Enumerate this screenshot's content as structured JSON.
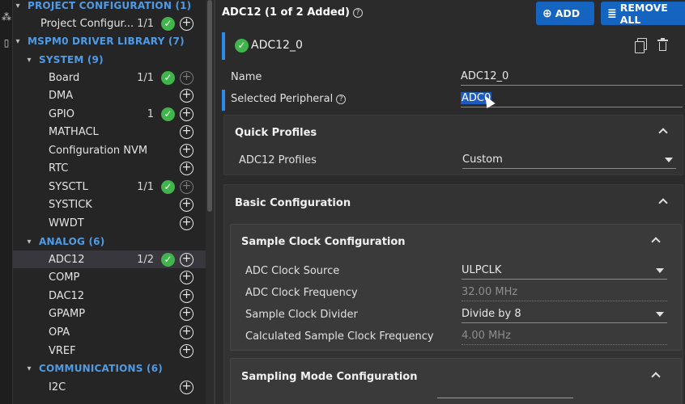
{
  "tree": {
    "project_configuration": "PROJECT CONFIGURATION (1)",
    "project_configuration_item": {
      "label": "Project Configur...",
      "count": "1/1"
    },
    "driver_library": "MSPM0 DRIVER LIBRARY (7)",
    "system_section": "SYSTEM (9)",
    "system_items": [
      {
        "label": "Board",
        "count": "1/1"
      },
      {
        "label": "DMA",
        "count": ""
      },
      {
        "label": "GPIO",
        "count": "1"
      },
      {
        "label": "MATHACL",
        "count": ""
      },
      {
        "label": "Configuration NVM",
        "count": ""
      },
      {
        "label": "RTC",
        "count": ""
      },
      {
        "label": "SYSCTL",
        "count": "1/1"
      },
      {
        "label": "SYSTICK",
        "count": ""
      },
      {
        "label": "WWDT",
        "count": ""
      }
    ],
    "analog_section": "ANALOG (6)",
    "analog_items": [
      {
        "label": "ADC12",
        "count": "1/2"
      },
      {
        "label": "COMP",
        "count": ""
      },
      {
        "label": "DAC12",
        "count": ""
      },
      {
        "label": "GPAMP",
        "count": ""
      },
      {
        "label": "OPA",
        "count": ""
      },
      {
        "label": "VREF",
        "count": ""
      }
    ],
    "communications_section": "COMMUNICATIONS (6)",
    "communications_items": [
      {
        "label": "I2C",
        "count": ""
      }
    ]
  },
  "main": {
    "title": "ADC12 (1 of 2 Added)",
    "add_label": "ADD",
    "remove_all_label": "REMOVE ALL",
    "instance_name": "ADC12_0",
    "name_label": "Name",
    "name_value": "ADC12_0",
    "selected_peripheral_label": "Selected Peripheral",
    "selected_peripheral_value": "ADC0",
    "quick_profiles": {
      "title": "Quick Profiles",
      "profiles_label": "ADC12 Profiles",
      "profiles_value": "Custom"
    },
    "basic_configuration": {
      "title": "Basic Configuration",
      "sample_clock": {
        "title": "Sample Clock Configuration",
        "clock_source_label": "ADC Clock Source",
        "clock_source_value": "ULPCLK",
        "clock_frequency_label": "ADC Clock Frequency",
        "clock_frequency_value": "32.00 MHz",
        "divider_label": "Sample Clock Divider",
        "divider_value": "Divide by 8",
        "calc_frequency_label": "Calculated Sample Clock Frequency",
        "calc_frequency_value": "4.00 MHz"
      },
      "sampling_mode": {
        "title": "Sampling Mode Configuration"
      }
    }
  },
  "colors": {
    "accent": "#1565c0",
    "section_blue": "#4f9be6",
    "check_green": "#3fb54b",
    "selection_bar": "#2d8ceb"
  }
}
